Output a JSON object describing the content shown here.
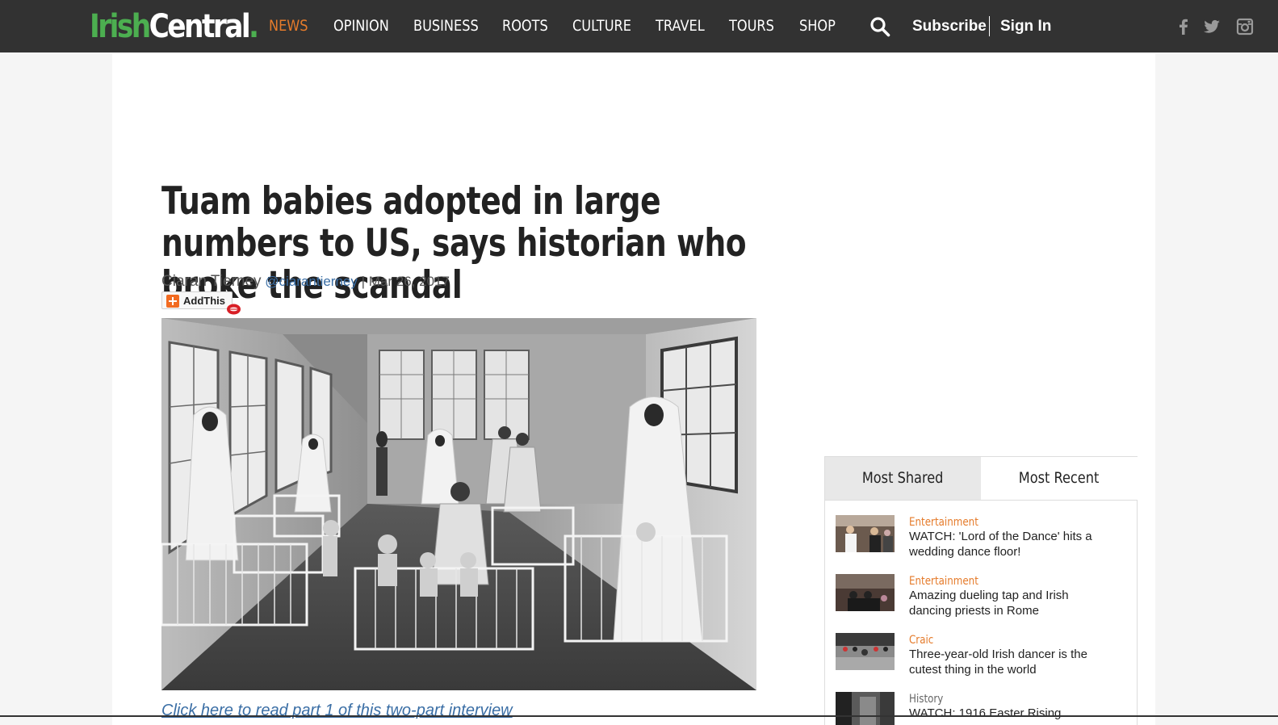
{
  "header": {
    "logo": {
      "part1": "Irish",
      "part2": "Central",
      "part3": "."
    },
    "nav": [
      "NEWS",
      "OPINION",
      "BUSINESS",
      "ROOTS",
      "CULTURE",
      "TRAVEL",
      "TOURS",
      "SHOP"
    ],
    "active_nav": "NEWS",
    "subscribe": "Subscribe",
    "sign_in": "Sign In",
    "social_icons": [
      "facebook-icon",
      "twitter-icon",
      "instagram-icon"
    ]
  },
  "article": {
    "headline": "Tuam babies adopted in large numbers to US, says historian who broke the scandal",
    "author": "Ciaran Tierney",
    "handle": "@ciarantierney",
    "separator": " | ",
    "date": "Mar 26, 2017",
    "share_button": "AddThis",
    "hero_image": "black-and-white photo of nuns and children in a nursery with cots",
    "part_link": "Click here to read part 1 of this two-part interview"
  },
  "sidebar": {
    "tabs": [
      "Most Shared",
      "Most Recent"
    ],
    "active_tab": "Most Shared",
    "stories": [
      {
        "category": "Entertainment",
        "title": "WATCH: 'Lord of the Dance' hits a wedding dance floor!"
      },
      {
        "category": "Entertainment",
        "title": "Amazing dueling tap and Irish dancing priests in Rome"
      },
      {
        "category": "Craic",
        "title": "Three-year-old Irish dancer is the cutest thing in the world"
      },
      {
        "category": "History",
        "title": "WATCH: 1916 Easter Rising"
      }
    ]
  },
  "colors": {
    "topbar": "#323232",
    "accent": "#e57b2b",
    "logo_green": "#4caf50",
    "link": "#3a6ea5"
  }
}
